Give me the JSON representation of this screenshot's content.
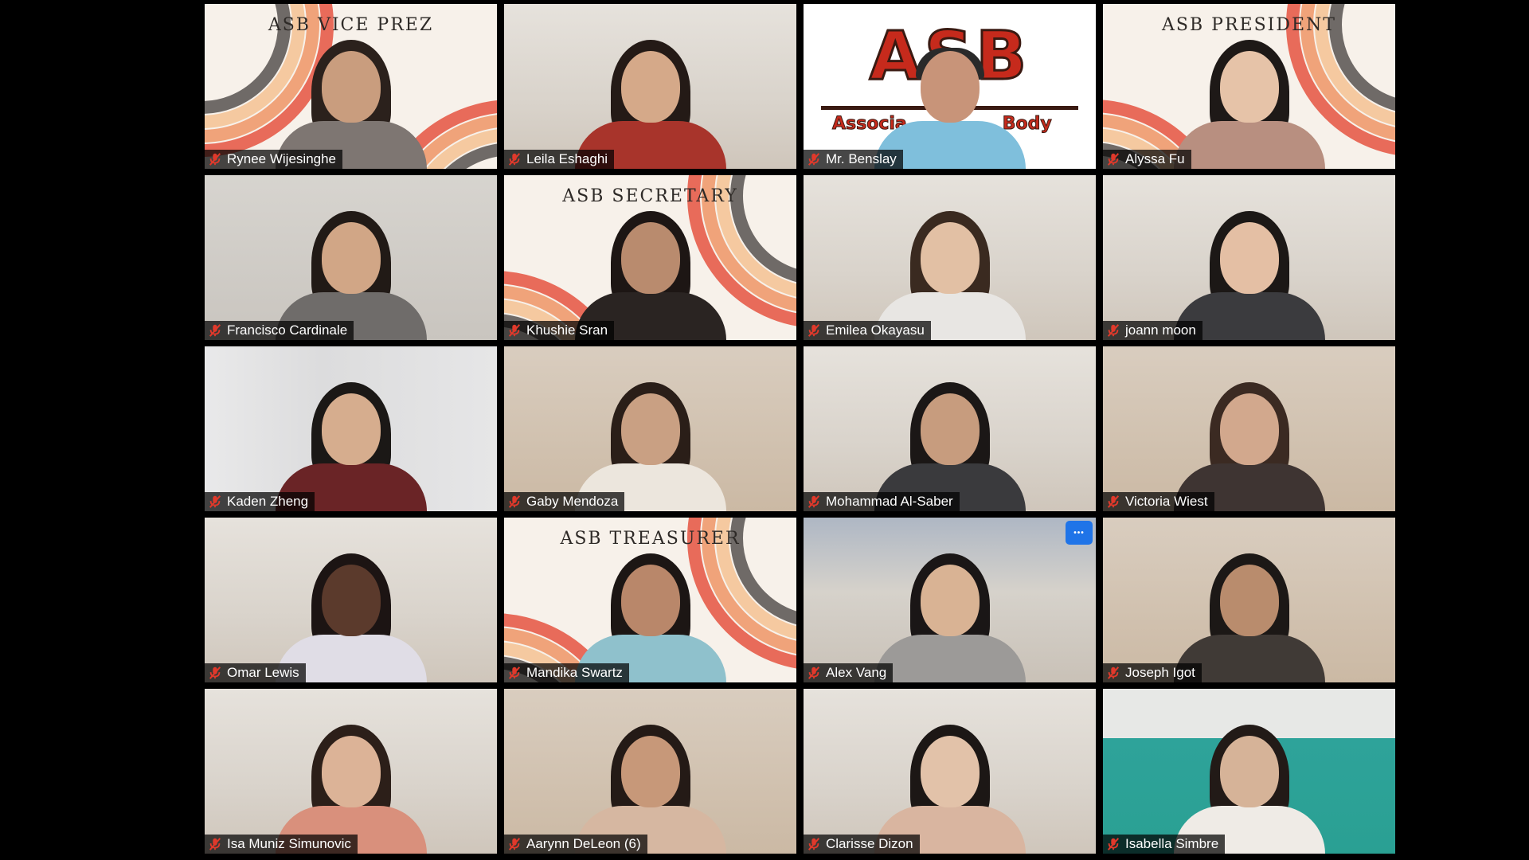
{
  "app": {
    "name": "Zoom gallery view"
  },
  "colors": {
    "active_speaker_border": "#d6e84a",
    "mic_muted": "#e0392b",
    "more_button": "#1f74e8",
    "asb_logo_red": "#c62a1c"
  },
  "icons": {
    "muted_mic": "microphone-muted-icon",
    "more_options": "ellipsis-icon"
  },
  "tiles": [
    {
      "name": "Rynee Wijesinghe",
      "banner": "ASB VICE PREZ",
      "scene": "banner",
      "hair": "#2b211c",
      "skin": "#c99d7e",
      "shirt": "#7e7672"
    },
    {
      "name": "Leila Eshaghi",
      "scene": "room-white",
      "hair": "#241a16",
      "skin": "#d5a989",
      "shirt": "#a8342b"
    },
    {
      "name": "Mr. Benslay",
      "scene": "asb",
      "logo": "ASB",
      "logo_sub": "Associa",
      "logo_sub_end": "Body",
      "hair": "#2a2a2a",
      "skin": "#c89479",
      "shirt": "#7fbfdc",
      "active": true
    },
    {
      "name": "Alyssa Fu",
      "banner": "ASB PRESIDENT",
      "scene": "banner",
      "hair": "#1e1917",
      "skin": "#e6c3a8",
      "shirt": "#b88f80"
    },
    {
      "name": "Francisco Cardinale",
      "scene": "room-gray",
      "hair": "#211a16",
      "skin": "#d1a686",
      "shirt": "#6f6c6a"
    },
    {
      "name": "Khushie Sran",
      "banner": "ASB SECRETARY",
      "scene": "banner",
      "hair": "#1d1614",
      "skin": "#b98b6e",
      "shirt": "#2a2422"
    },
    {
      "name": "Emilea Okayasu",
      "scene": "room-white",
      "hair": "#3a2a20",
      "skin": "#e2c0a4",
      "shirt": "#e8e6e3"
    },
    {
      "name": "joann moon",
      "scene": "room-white",
      "hair": "#1c1816",
      "skin": "#e4bfa4",
      "shirt": "#3b3b3e"
    },
    {
      "name": "Kaden Zheng",
      "scene": "sheet",
      "hair": "#1b1816",
      "skin": "#d6ad8e",
      "shirt": "#6a2426"
    },
    {
      "name": "Gaby Mendoza",
      "scene": "room-warm",
      "hair": "#2a1e18",
      "skin": "#c9a083",
      "shirt": "#ece6dd"
    },
    {
      "name": "Mohammad Al-Saber",
      "scene": "room-white",
      "hair": "#1b1716",
      "skin": "#c79c7e",
      "shirt": "#3a3a3d"
    },
    {
      "name": "Victoria Wiest",
      "scene": "room-warm",
      "hair": "#3b2a22",
      "skin": "#d2a88d",
      "shirt": "#3e3432"
    },
    {
      "name": "Omar Lewis",
      "scene": "room-white",
      "hair": "#1c1413",
      "skin": "#5b3a2c",
      "shirt": "#e0dde6"
    },
    {
      "name": "Mandika Swartz",
      "banner": "ASB TREASURER",
      "scene": "banner",
      "hair": "#1c1614",
      "skin": "#b9876a",
      "shirt": "#8fc1cc"
    },
    {
      "name": "Alex Vang",
      "scene": "room-blue",
      "hair": "#1a1616",
      "skin": "#d9b394",
      "shirt": "#9c9a98",
      "more": true
    },
    {
      "name": "Joseph Igot",
      "scene": "room-warm",
      "hair": "#1c1816",
      "skin": "#b98c6d",
      "shirt": "#403a36"
    },
    {
      "name": "Isa Muniz Simunovic",
      "scene": "room-white",
      "hair": "#2c1f19",
      "skin": "#dcb397",
      "shirt": "#d9907c"
    },
    {
      "name": "Aarynn DeLeon (6)",
      "scene": "room-warm",
      "hair": "#241a16",
      "skin": "#c79879",
      "shirt": "#d6b7a1"
    },
    {
      "name": "Clarisse Dizon",
      "scene": "room-white",
      "hair": "#1c1715",
      "skin": "#e2c2a9",
      "shirt": "#d9b5a0"
    },
    {
      "name": "Isabella Simbre",
      "scene": "teal",
      "hair": "#221a17",
      "skin": "#d6b398",
      "shirt": "#efebe6"
    }
  ]
}
